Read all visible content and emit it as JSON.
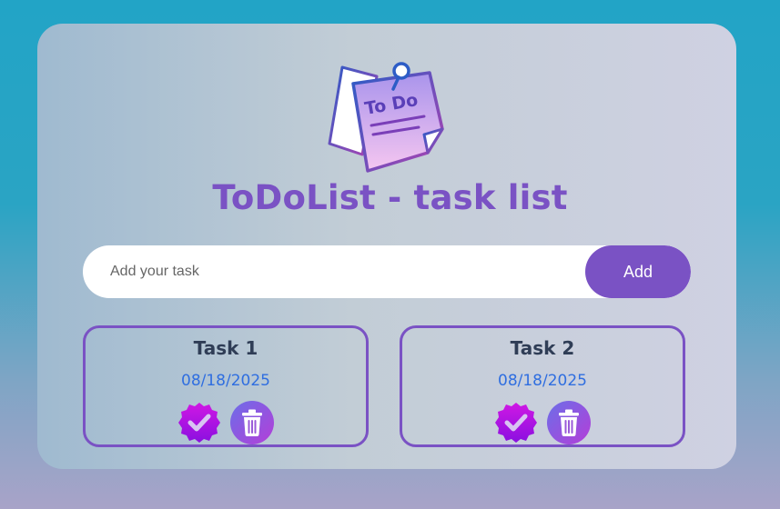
{
  "app": {
    "title": "ToDoList - task list",
    "logo_text": "To Do"
  },
  "form": {
    "input_value": "",
    "input_placeholder": "Add your task",
    "add_label": "Add"
  },
  "tasks": [
    {
      "name": "Task 1",
      "date": "08/18/2025",
      "complete_icon": "check-badge-icon",
      "delete_icon": "trash-icon"
    },
    {
      "name": "Task 2",
      "date": "08/18/2025",
      "complete_icon": "check-badge-icon",
      "delete_icon": "trash-icon"
    }
  ],
  "colors": {
    "accent": "#7a52c4",
    "date": "#2f6ee0",
    "task_text": "#2f3d56"
  }
}
